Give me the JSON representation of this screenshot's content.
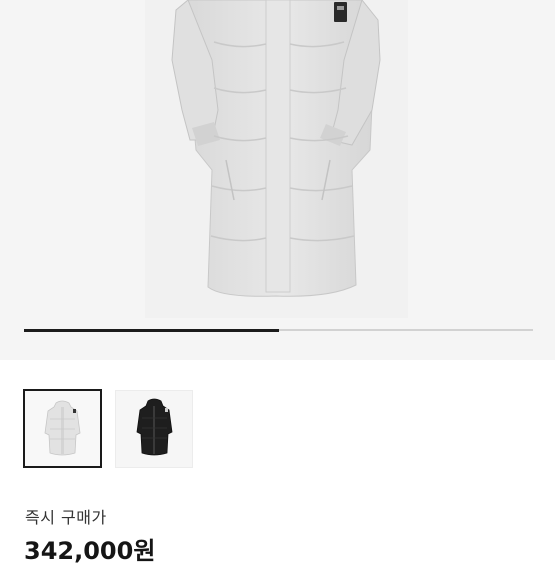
{
  "gallery": {
    "main_image": "light-gray-long-down-coat",
    "images": [
      {
        "name": "light-gray-long-down-coat",
        "selected": true
      },
      {
        "name": "black-long-down-coat",
        "selected": false
      }
    ],
    "progress": 0.5
  },
  "purchase": {
    "label": "즉시 구매가",
    "price": "342,000원"
  },
  "colors": {
    "background": "#ffffff",
    "gallery_background": "#f5f5f5",
    "coat_light": "#e4e4e4",
    "coat_dark": "#1e1e1e",
    "progress_fill": "#1c1c1c",
    "progress_track": "#d2d2d2"
  }
}
